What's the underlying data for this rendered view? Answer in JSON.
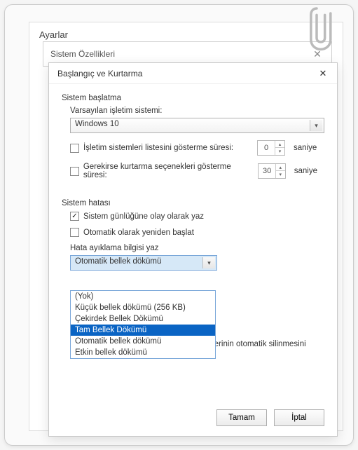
{
  "settings": {
    "title": "Ayarlar"
  },
  "sysprop": {
    "title": "Sistem Özellikleri"
  },
  "dlg": {
    "title": "Başlangıç ve Kurtarma",
    "startup": {
      "header": "Sistem başlatma",
      "default_os_label": "Varsayılan işletim sistemi:",
      "default_os_value": "Windows 10",
      "show_os_list": {
        "checked": false,
        "label": "İşletim sistemleri listesini gösterme süresi:",
        "value": "0",
        "unit": "saniye"
      },
      "show_recovery": {
        "checked": false,
        "label": "Gerekirse kurtarma seçenekleri gösterme süresi:",
        "value": "30",
        "unit": "saniye"
      }
    },
    "failure": {
      "header": "Sistem hatası",
      "write_log": {
        "checked": true,
        "label": "Sistem günlüğüne olay olarak yaz"
      },
      "auto_restart": {
        "checked": false,
        "label": "Otomatik olarak yeniden başlat"
      },
      "debug_label": "Hata ayıklama bilgisi yaz",
      "debug_selected": "Otomatik bellek dökümü",
      "debug_options": [
        "(Yok)",
        "Küçük bellek dökümü (256 KB)",
        "Çekirdek Bellek Dökümü",
        "Tam Bellek Dökümü",
        "Otomatik bellek dökümü",
        "Etkin bellek dökümü"
      ],
      "highlighted_index": 3,
      "disable_auto_delete": {
        "checked": false,
        "label": "Disk alanı azaldığında bellek dökümlerinin otomatik silinmesini devre dışı bırak"
      }
    },
    "buttons": {
      "ok": "Tamam",
      "cancel": "İptal"
    }
  }
}
